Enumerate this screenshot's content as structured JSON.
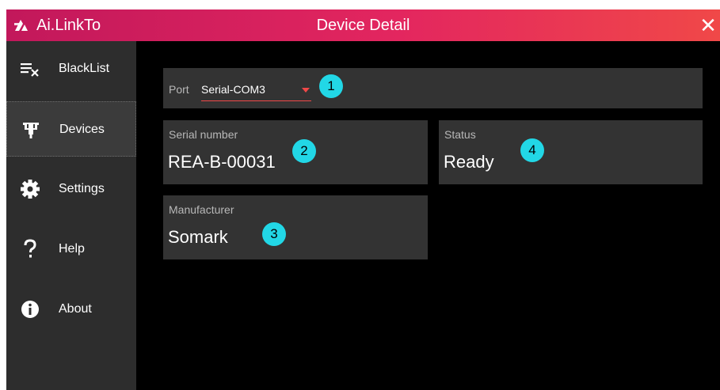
{
  "window": {
    "app_name": "Ai.LinkTo",
    "title": "Device Detail",
    "close_glyph": "✕",
    "accent_colors": [
      "#c2185b",
      "#f04848"
    ]
  },
  "sidebar": {
    "items": [
      {
        "label": "BlackList",
        "icon": "blacklist-icon",
        "active": false
      },
      {
        "label": "Devices",
        "icon": "device-plug-icon",
        "active": true
      },
      {
        "label": "Settings",
        "icon": "gear-icon",
        "active": false
      },
      {
        "label": "Help",
        "icon": "question-icon",
        "active": false
      },
      {
        "label": "About",
        "icon": "info-icon",
        "active": false
      }
    ]
  },
  "main": {
    "port": {
      "label": "Port",
      "value": "Serial-COM3",
      "badge": "1"
    },
    "serial_number": {
      "label": "Serial number",
      "value": "REA-B-00031",
      "badge": "2"
    },
    "manufacturer": {
      "label": "Manufacturer",
      "value": "Somark",
      "badge": "3"
    },
    "status": {
      "label": "Status",
      "value": "Ready",
      "badge": "4"
    }
  }
}
